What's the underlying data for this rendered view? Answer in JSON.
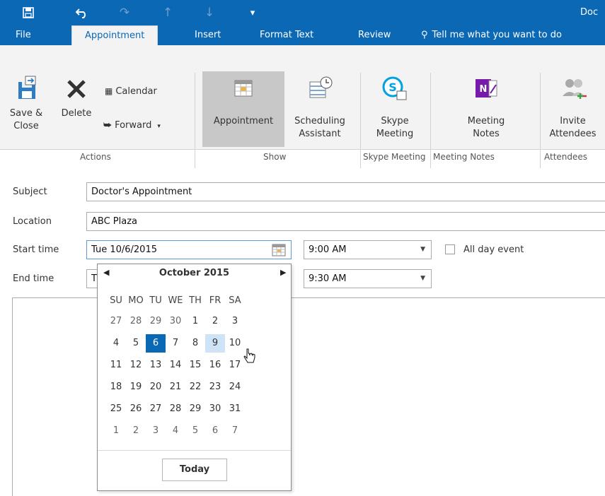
{
  "window": {
    "title": "Doc"
  },
  "tabs": [
    "File",
    "Appointment",
    "Insert",
    "Format Text",
    "Review"
  ],
  "tell_me": "Tell me what you want to do",
  "ribbon": {
    "actions": {
      "save_close_line1": "Save &",
      "save_close_line2": "Close",
      "delete": "Delete",
      "calendar": "Calendar",
      "forward": "Forward",
      "group": "Actions"
    },
    "show": {
      "appointment": "Appointment",
      "scheduling_line1": "Scheduling",
      "scheduling_line2": "Assistant",
      "group": "Show"
    },
    "skype": {
      "line1": "Skype",
      "line2": "Meeting",
      "group": "Skype Meeting"
    },
    "notes": {
      "line1": "Meeting",
      "line2": "Notes",
      "group": "Meeting Notes"
    },
    "attendees": {
      "line1": "Invite",
      "line2": "Attendees",
      "group": "Attendees"
    }
  },
  "form": {
    "subject_label": "Subject",
    "subject": "Doctor's Appointment",
    "location_label": "Location",
    "location": "ABC Plaza",
    "start_label": "Start time",
    "start_date": "Tue 10/6/2015",
    "start_time": "9:00 AM",
    "allday_label": "All day event",
    "end_label": "End time",
    "end_date": "T",
    "end_time": "9:30 AM"
  },
  "datepicker": {
    "month": "October 2015",
    "weekdays": [
      "SU",
      "MO",
      "TU",
      "WE",
      "TH",
      "FR",
      "SA"
    ],
    "weeks": [
      [
        "27",
        "28",
        "29",
        "30",
        "1",
        "2",
        "3"
      ],
      [
        "4",
        "5",
        "6",
        "7",
        "8",
        "9",
        "10"
      ],
      [
        "11",
        "12",
        "13",
        "14",
        "15",
        "16",
        "17"
      ],
      [
        "18",
        "19",
        "20",
        "21",
        "22",
        "23",
        "24"
      ],
      [
        "25",
        "26",
        "27",
        "28",
        "29",
        "30",
        "31"
      ],
      [
        "1",
        "2",
        "3",
        "4",
        "5",
        "6",
        "7"
      ]
    ],
    "selected_day": "6",
    "hover_day": "9",
    "today_label": "Today"
  }
}
